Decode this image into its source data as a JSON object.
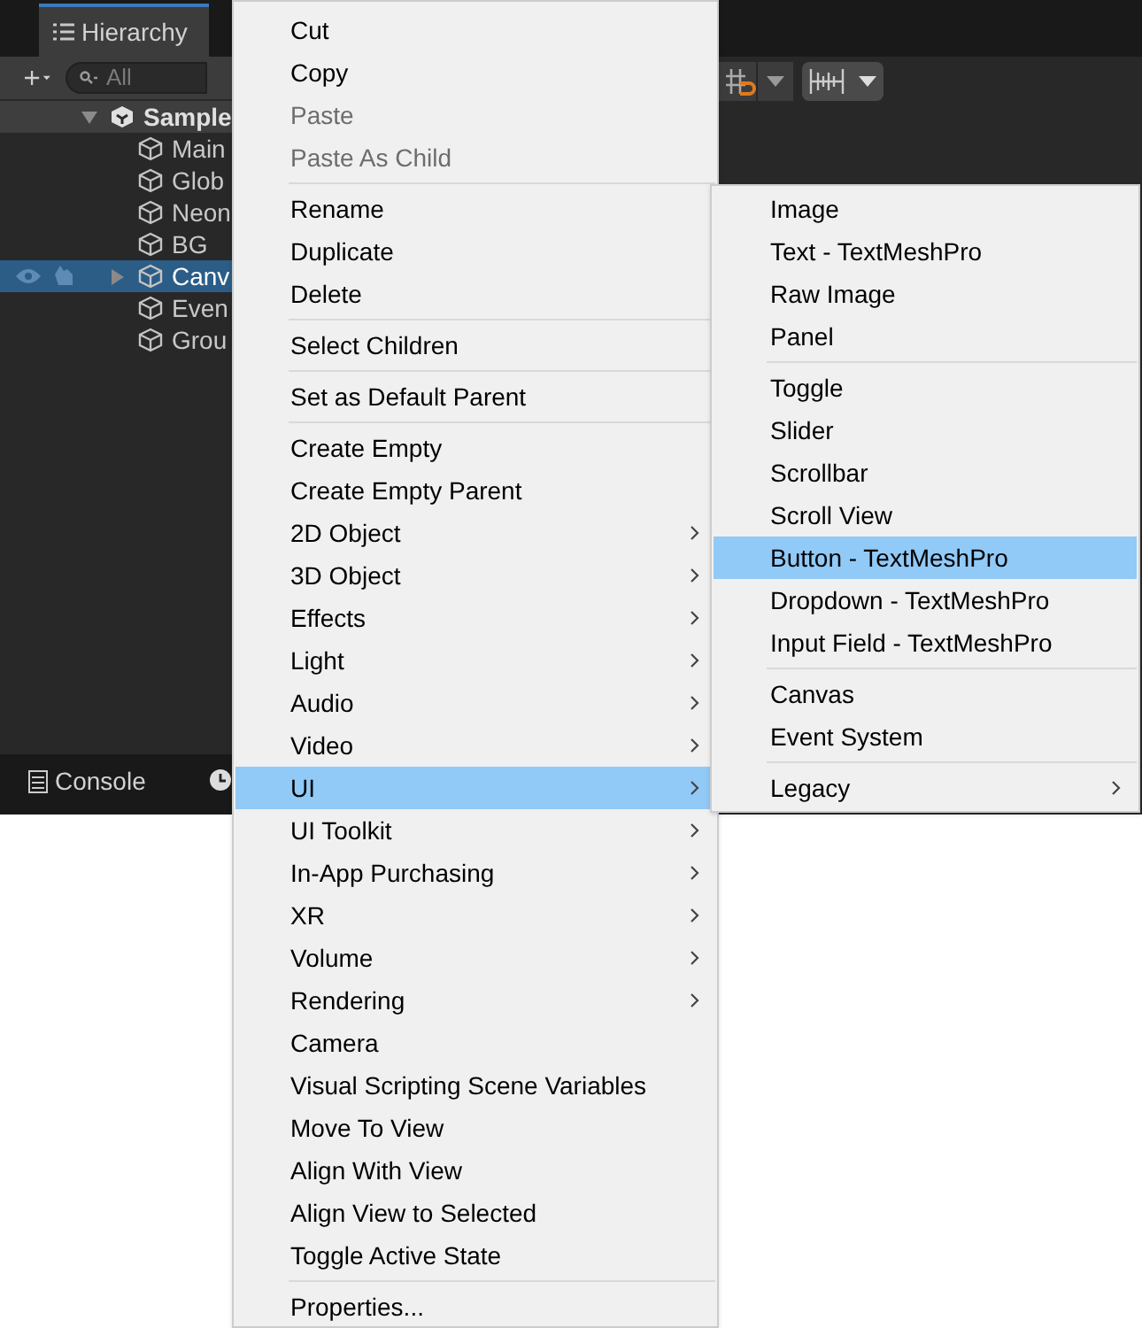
{
  "hierarchy": {
    "tab": "Hierarchy",
    "search": {
      "placeholder": "All"
    },
    "rows": [
      {
        "label": "Sample",
        "kind": "scene",
        "selected": false,
        "expanded": true
      },
      {
        "label": "Main",
        "kind": "object",
        "selected": false
      },
      {
        "label": "Glob",
        "kind": "object",
        "selected": false
      },
      {
        "label": "Neon",
        "kind": "object",
        "selected": false
      },
      {
        "label": "BG",
        "kind": "object",
        "selected": false
      },
      {
        "label": "Canv",
        "kind": "object",
        "selected": true,
        "expanded": false
      },
      {
        "label": "Even",
        "kind": "object",
        "selected": false
      },
      {
        "label": "Grou",
        "kind": "object",
        "selected": false
      }
    ]
  },
  "console_tab": "Console",
  "context_menu": [
    {
      "kind": "item",
      "label": "Cut",
      "disabled": false
    },
    {
      "kind": "item",
      "label": "Copy",
      "disabled": false
    },
    {
      "kind": "item",
      "label": "Paste",
      "disabled": true
    },
    {
      "kind": "item",
      "label": "Paste As Child",
      "disabled": true
    },
    {
      "kind": "separator"
    },
    {
      "kind": "item",
      "label": "Rename",
      "disabled": false
    },
    {
      "kind": "item",
      "label": "Duplicate",
      "disabled": false
    },
    {
      "kind": "item",
      "label": "Delete",
      "disabled": false
    },
    {
      "kind": "separator"
    },
    {
      "kind": "item",
      "label": "Select Children",
      "disabled": false
    },
    {
      "kind": "separator"
    },
    {
      "kind": "item",
      "label": "Set as Default Parent",
      "disabled": false
    },
    {
      "kind": "separator"
    },
    {
      "kind": "item",
      "label": "Create Empty",
      "disabled": false
    },
    {
      "kind": "item",
      "label": "Create Empty Parent",
      "disabled": false
    },
    {
      "kind": "submenu",
      "label": "2D Object",
      "selected": false
    },
    {
      "kind": "submenu",
      "label": "3D Object",
      "selected": false
    },
    {
      "kind": "submenu",
      "label": "Effects",
      "selected": false
    },
    {
      "kind": "submenu",
      "label": "Light",
      "selected": false
    },
    {
      "kind": "submenu",
      "label": "Audio",
      "selected": false
    },
    {
      "kind": "submenu",
      "label": "Video",
      "selected": false
    },
    {
      "kind": "submenu",
      "label": "UI",
      "selected": true
    },
    {
      "kind": "submenu",
      "label": "UI Toolkit",
      "selected": false
    },
    {
      "kind": "submenu",
      "label": "In-App Purchasing",
      "selected": false
    },
    {
      "kind": "submenu",
      "label": "XR",
      "selected": false
    },
    {
      "kind": "submenu",
      "label": "Volume",
      "selected": false
    },
    {
      "kind": "submenu",
      "label": "Rendering",
      "selected": false
    },
    {
      "kind": "item",
      "label": "Camera",
      "disabled": false
    },
    {
      "kind": "item",
      "label": "Visual Scripting Scene Variables",
      "disabled": false
    },
    {
      "kind": "item",
      "label": "Move To View",
      "disabled": false
    },
    {
      "kind": "item",
      "label": "Align With View",
      "disabled": false
    },
    {
      "kind": "item",
      "label": "Align View to Selected",
      "disabled": false
    },
    {
      "kind": "item",
      "label": "Toggle Active State",
      "disabled": false
    },
    {
      "kind": "separator"
    },
    {
      "kind": "item",
      "label": "Properties...",
      "disabled": false
    }
  ],
  "ui_submenu": [
    {
      "kind": "item",
      "label": "Image",
      "selected": false
    },
    {
      "kind": "item",
      "label": "Text - TextMeshPro",
      "selected": false
    },
    {
      "kind": "item",
      "label": "Raw Image",
      "selected": false
    },
    {
      "kind": "item",
      "label": "Panel",
      "selected": false
    },
    {
      "kind": "separator"
    },
    {
      "kind": "item",
      "label": "Toggle",
      "selected": false
    },
    {
      "kind": "item",
      "label": "Slider",
      "selected": false
    },
    {
      "kind": "item",
      "label": "Scrollbar",
      "selected": false
    },
    {
      "kind": "item",
      "label": "Scroll View",
      "selected": false
    },
    {
      "kind": "item",
      "label": "Button - TextMeshPro",
      "selected": true
    },
    {
      "kind": "item",
      "label": "Dropdown - TextMeshPro",
      "selected": false
    },
    {
      "kind": "item",
      "label": "Input Field - TextMeshPro",
      "selected": false
    },
    {
      "kind": "separator"
    },
    {
      "kind": "item",
      "label": "Canvas",
      "selected": false
    },
    {
      "kind": "item",
      "label": "Event System",
      "selected": false
    },
    {
      "kind": "separator"
    },
    {
      "kind": "submenu",
      "label": "Legacy",
      "selected": false
    }
  ]
}
